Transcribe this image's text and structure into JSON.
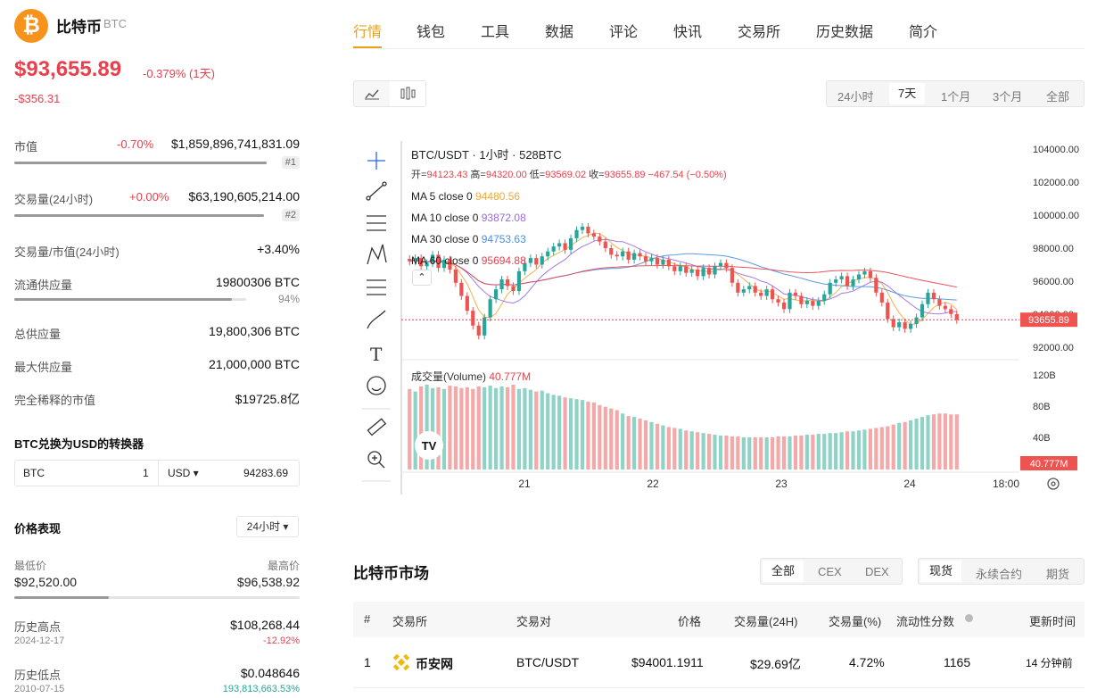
{
  "coin": {
    "logo_char": "₿",
    "name": "比特币",
    "symbol": "BTC"
  },
  "price": {
    "value": "$93,655.89",
    "change_pct": "-0.379% (1天)",
    "change_abs": "-$356.31"
  },
  "stats": {
    "market_cap": {
      "label": "市值",
      "pct": "-0.70%",
      "value": "$1,859,896,741,831.09",
      "rank": "#1"
    },
    "volume": {
      "label": "交易量(24小时)",
      "pct": "+0.00%",
      "value": "$63,190,605,214.00",
      "rank": "#2"
    },
    "vol_mcap": {
      "label": "交易量/市值(24小时)",
      "value": "+3.40%"
    },
    "circulating": {
      "label": "流通供应量",
      "value": "19800306 BTC",
      "pct": "94%",
      "fill": 0.94
    },
    "total_supply": {
      "label": "总供应量",
      "value": "19,800,306 BTC"
    },
    "max_supply": {
      "label": "最大供应量",
      "value": "21,000,000 BTC"
    },
    "fdv": {
      "label": "完全稀释的市值",
      "value": "$19725.8亿"
    }
  },
  "converter": {
    "title": "BTC兑换为USD的转换器",
    "from": "BTC",
    "amount": "1",
    "to": "USD ▾",
    "result": "94283.69"
  },
  "performance": {
    "title": "价格表现",
    "period": "24小时 ▾",
    "low_label": "最低价",
    "low": "$92,520.00",
    "high_label": "最高价",
    "high": "$96,538.92",
    "range_fill": 0.33,
    "ath_label": "历史高点",
    "ath": "$108,268.44",
    "ath_date": "2024-12-17",
    "ath_pct": "-12.92%",
    "atl_label": "历史低点",
    "atl": "$0.048646",
    "atl_date": "2010-07-15",
    "atl_pct": "193,813,663.53%"
  },
  "tabs": [
    "行情",
    "钱包",
    "工具",
    "数据",
    "评论",
    "快讯",
    "交易所",
    "历史数据",
    "简介"
  ],
  "ranges": [
    "24小时",
    "7天",
    "1个月",
    "3个月",
    "全部"
  ],
  "chart_data": {
    "type": "candlestick",
    "title": "BTC/USDT · 1小时 · 528BTC",
    "ohlc_line": {
      "o_label": "开=",
      "o": "94123.43",
      "h_label": "高=",
      "h": "94320.00",
      "l_label": "低=",
      "l": "93569.02",
      "c_label": "收=",
      "c": "93655.89",
      "chg": "−467.54 (−0.50%)"
    },
    "ma": [
      {
        "name": "MA 5 close 0",
        "value": "94480.56",
        "color": "#f2a93b"
      },
      {
        "name": "MA 10 close 0",
        "value": "93872.08",
        "color": "#9c6ade"
      },
      {
        "name": "MA 30 close 0",
        "value": "94753.63",
        "color": "#4a90e2"
      },
      {
        "name": "MA 60 close 0",
        "value": "95694.88",
        "color": "#e8414d"
      }
    ],
    "yticks": [
      "104000.00",
      "102000.00",
      "100000.00",
      "98000.00",
      "96000.00",
      "94000.00",
      "92000.00"
    ],
    "ylim": [
      91500,
      104500
    ],
    "last_price": "93655.89",
    "volume_title": "成交量(Volume)",
    "volume_value": "40.777M",
    "vol_ticks": [
      "120B",
      "80B",
      "40B"
    ],
    "xticks": [
      "21",
      "22",
      "23",
      "24",
      "18:00"
    ],
    "close": [
      97200,
      97400,
      96900,
      97100,
      97600,
      96800,
      97300,
      96700,
      95900,
      95100,
      94200,
      93300,
      92700,
      93800,
      94900,
      95500,
      96100,
      95700,
      95400,
      96600,
      97100,
      97400,
      97000,
      97500,
      97800,
      98100,
      98300,
      97900,
      98600,
      99100,
      99300,
      98900,
      98700,
      98400,
      98000,
      97600,
      97500,
      97800,
      97300,
      97700,
      97500,
      97200,
      97400,
      97000,
      97300,
      96900,
      96600,
      96900,
      96500,
      96700,
      96300,
      96800,
      96400,
      96900,
      97100,
      96800,
      95900,
      95300,
      95500,
      95700,
      95300,
      95100,
      95500,
      94900,
      94700,
      94300,
      95300,
      95100,
      94600,
      94800,
      94500,
      94800,
      95200,
      95900,
      96100,
      96300,
      95700,
      96100,
      96400,
      96600,
      96200,
      95300,
      94700,
      93700,
      93200,
      93500,
      93100,
      93400,
      93800,
      94600,
      95300,
      94900,
      94500,
      94300,
      94000,
      93650
    ],
    "volumes": [
      95,
      92,
      98,
      100,
      96,
      97,
      95,
      99,
      98,
      96,
      97,
      95,
      98,
      97,
      99,
      96,
      98,
      97,
      100,
      95,
      96,
      94,
      92,
      93,
      90,
      88,
      87,
      85,
      84,
      83,
      82,
      80,
      79,
      76,
      74,
      72,
      70,
      66,
      63,
      62,
      60,
      58,
      56,
      54,
      52,
      50,
      49,
      48,
      46,
      45,
      44,
      43,
      42,
      41,
      40,
      40,
      39,
      39,
      38,
      38,
      38,
      38,
      38,
      38,
      39,
      39,
      39,
      40,
      40,
      41,
      41,
      42,
      42,
      43,
      43,
      44,
      45,
      45,
      46,
      47,
      48,
      49,
      50,
      51,
      53,
      55,
      56,
      58,
      60,
      62,
      64,
      65,
      66,
      66,
      65,
      65
    ]
  },
  "market": {
    "title": "比特币市场",
    "filters": [
      "全部",
      "CEX",
      "DEX"
    ],
    "types": [
      "现货",
      "永续合约",
      "期货"
    ],
    "headers": [
      "#",
      "交易所",
      "交易对",
      "价格",
      "交易量(24H)",
      "交易量(%)",
      "流动性分数",
      "更新时间"
    ],
    "rows": [
      {
        "rank": "1",
        "exchange": "币安网",
        "pair": "BTC/USDT",
        "price": "$94001.1911",
        "volume": "$29.69亿",
        "vol_pct": "4.72%",
        "liquidity": "1165",
        "updated": "14 分钟前"
      }
    ]
  },
  "colors": {
    "up": "#26a69a",
    "down": "#ef5350",
    "accent": "#e5a21b"
  }
}
